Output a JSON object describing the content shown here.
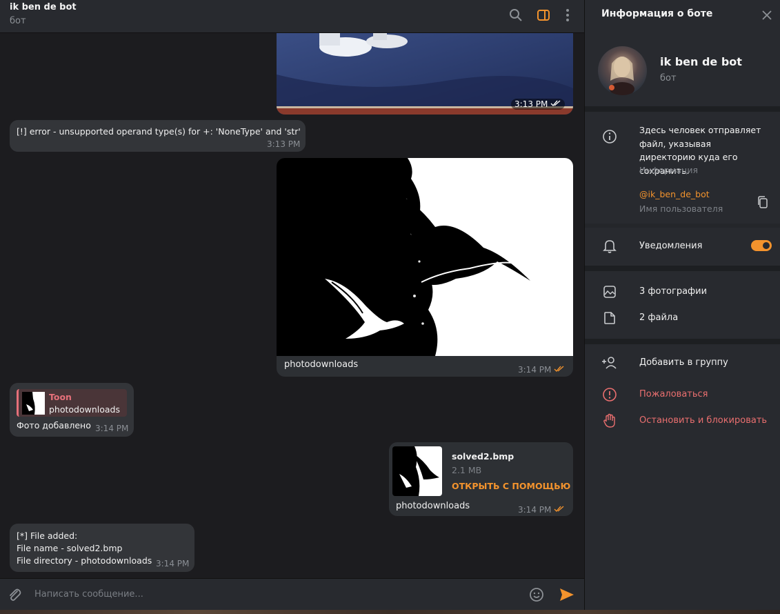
{
  "chat": {
    "title": "ik ben de bot",
    "subtitle": "бот",
    "input_placeholder": "Написать сообщение..."
  },
  "messages": {
    "m1_time": "3:13 PM",
    "m2_text": "[!] error - unsupported operand type(s) for +: 'NoneType' and 'str'",
    "m2_time": "3:13 PM",
    "m3_caption": "photodownloads",
    "m3_time": "3:14 PM",
    "m4_reply_author": "Toon",
    "m4_reply_text": "photodownloads",
    "m4_text": "Фото добавлено",
    "m4_time": "3:14 PM",
    "m5_file_name": "solved2.bmp",
    "m5_file_size": "2.1 MB",
    "m5_open_with": "ОТКРЫТЬ С ПОМОЩЬЮ",
    "m5_caption": "photodownloads",
    "m5_time": "3:14 PM",
    "m6_line1": "[*] File added:",
    "m6_line2": "File name - solved2.bmp",
    "m6_line3": "File directory - photodownloads",
    "m6_time": "3:14 PM"
  },
  "panel": {
    "header": "Информация о боте",
    "bot_name": "ik ben de bot",
    "bot_subtitle": "бот",
    "info_text": "Здесь человек отправляет файл, указывая директорию куда его сохранить.",
    "info_label": "Информация",
    "username": "@ik_ben_de_bot",
    "username_label": "Имя пользователя",
    "notifications": "Уведомления",
    "photos": "3 фотографии",
    "files": "2 файла",
    "add_to_group": "Добавить в группу",
    "report": "Пожаловаться",
    "block": "Остановить и блокировать"
  },
  "colors": {
    "accent": "#f3932d",
    "danger": "#ea6f6f",
    "reply_author": "#e6707a"
  }
}
